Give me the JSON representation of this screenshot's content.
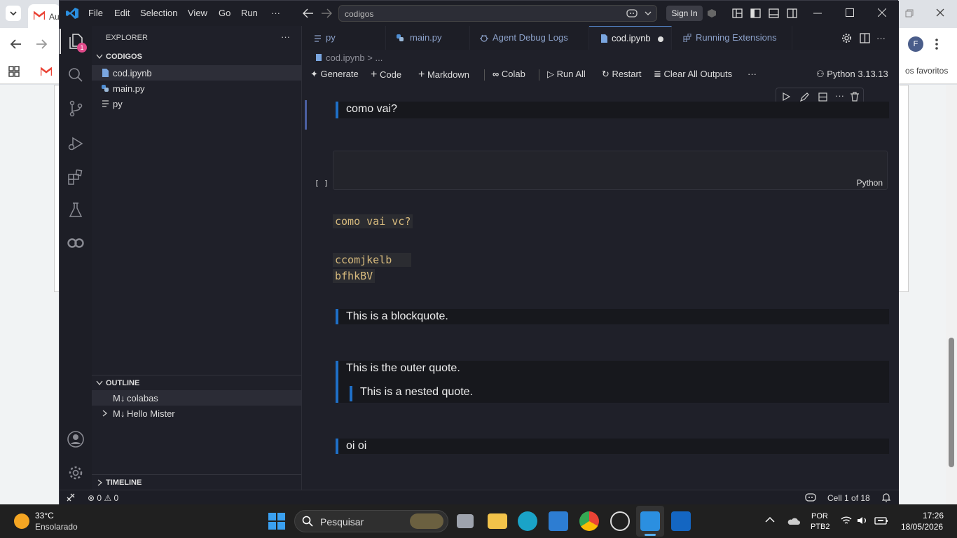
{
  "chrome": {
    "tab_label": "Au",
    "bookmarks_text": "os favoritos",
    "profile_initial": "F"
  },
  "vscode": {
    "menu": [
      "File",
      "Edit",
      "Selection",
      "View",
      "Go",
      "Run",
      "···"
    ],
    "command_center": "codigos",
    "sign_in": "Sign In",
    "activity_badge": "1",
    "explorer_title": "EXPLORER",
    "explorer_more": "···",
    "folder_name": "CODIGOS",
    "files": [
      "cod.ipynb",
      "main.py",
      "py"
    ],
    "outline_title": "OUTLINE",
    "outline_items": [
      "colabas",
      "Hello Mister"
    ],
    "outline_prefix": "M↓",
    "timeline_title": "TIMELINE",
    "tabs": [
      "py",
      "main.py",
      "Agent Debug Logs",
      "cod.ipynb",
      "Running Extensions"
    ],
    "breadcrumb": "cod.ipynb",
    "breadcrumb_more": "...",
    "toolbar": {
      "generate": "Generate",
      "code": "Code",
      "markdown": "Markdown",
      "colab": "Colab",
      "run_all": "Run All",
      "restart": "Restart",
      "clear_outputs": "Clear All Outputs",
      "more": "···",
      "kernel": "Python 3.13.13"
    },
    "cells": {
      "quote1": "como vai?",
      "code_cell_bracket": "[ ]",
      "code_cell_lang": "Python",
      "inline_code1": "como vai vc?",
      "code_line1": "ccomjkelb ",
      "code_line2": "bfhkBV",
      "quote2": "This is a blockquote.",
      "outer_quote": "This is the outer quote.",
      "nested_quote": "This is a nested quote.",
      "quote3": "oi oi"
    },
    "status": {
      "errors": "0",
      "warnings": "0",
      "cell_position": "Cell 1 of 18"
    }
  },
  "taskbar": {
    "weather_temp": "33°C",
    "weather_desc": "Ensolarado",
    "search_placeholder": "Pesquisar",
    "lang_line1": "POR",
    "lang_line2": "PTB2",
    "time": "17:26",
    "date": "18/05/2026"
  },
  "colors": {
    "accent": "#1f6fc6",
    "code_text": "#d7ba7d",
    "badge": "#e14a8a"
  }
}
